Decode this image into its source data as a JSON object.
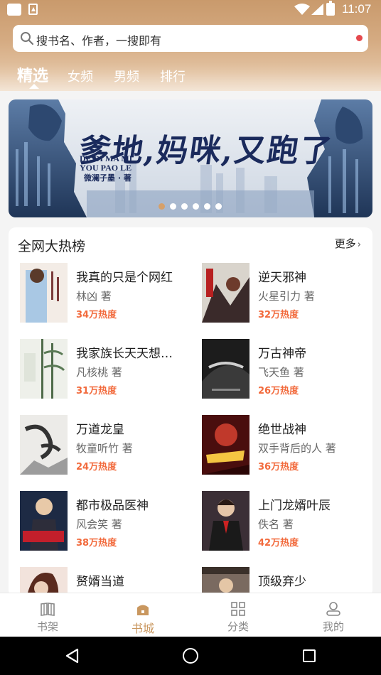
{
  "status_bar": {
    "time": "11:07"
  },
  "search": {
    "placeholder": "搜书名、作者，一搜即有"
  },
  "tabs": [
    {
      "label": "精选",
      "active": true
    },
    {
      "label": "女频",
      "active": false
    },
    {
      "label": "男频",
      "active": false
    },
    {
      "label": "排行",
      "active": false
    }
  ],
  "banner": {
    "title": "爹地,妈咪,又跑了",
    "pinyin_line1": "DE DI MA MI",
    "pinyin_line2": "YOU PAO LE",
    "author": "微澜子墨 · 著",
    "slide_count": 6,
    "active_slide": 1
  },
  "hot_list": {
    "title": "全网大热榜",
    "more_label": "更多",
    "books": [
      {
        "title": "我真的只是个网红",
        "author": "林凶 著",
        "heat": "34万热度"
      },
      {
        "title": "逆天邪神",
        "author": "火星引力 著",
        "heat": "32万热度"
      },
      {
        "title": "我家族长天天想…",
        "author": "凡核桃 著",
        "heat": "31万热度"
      },
      {
        "title": "万古神帝",
        "author": "飞天鱼 著",
        "heat": "26万热度"
      },
      {
        "title": "万道龙皇",
        "author": "牧童听竹 著",
        "heat": "24万热度"
      },
      {
        "title": "绝世战神",
        "author": "双手背后的人 著",
        "heat": "36万热度"
      },
      {
        "title": "都市极品医神",
        "author": "风会笑 著",
        "heat": "38万热度"
      },
      {
        "title": "上门龙婿叶辰",
        "author": "佚名 著",
        "heat": "42万热度"
      },
      {
        "title": "赘婿当道",
        "author": "",
        "heat": ""
      },
      {
        "title": "顶级弃少",
        "author": "",
        "heat": ""
      }
    ]
  },
  "bottom_nav": [
    {
      "label": "书架",
      "icon": "bookshelf-icon",
      "active": false
    },
    {
      "label": "书城",
      "icon": "home-icon",
      "active": true
    },
    {
      "label": "分类",
      "icon": "category-grid-icon",
      "active": false
    },
    {
      "label": "我的",
      "icon": "profile-icon",
      "active": false
    }
  ],
  "colors": {
    "accent": "#c9975f",
    "heat": "#f26a3c",
    "header": "#d5ab82",
    "notification_dot": "#e5484d"
  }
}
